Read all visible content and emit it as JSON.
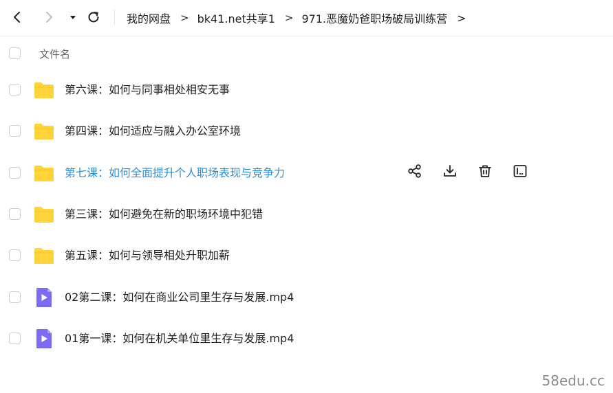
{
  "breadcrumb": {
    "items": [
      "我的网盘",
      "bk41.net共享1",
      "971.恶魔奶爸职场破局训练营"
    ],
    "separator": ">"
  },
  "list_header": {
    "name_label": "文件名"
  },
  "files": [
    {
      "name": "第六课：如何与同事相处相安无事",
      "type": "folder"
    },
    {
      "name": "第四课：如何适应与融入办公室环境",
      "type": "folder"
    },
    {
      "name": "第七课：如何全面提升个人职场表现与竞争力",
      "type": "folder",
      "hovered": true
    },
    {
      "name": "第三课：如何避免在新的职场环境中犯错",
      "type": "folder"
    },
    {
      "name": "第五课：如何与领导相处升职加薪",
      "type": "folder"
    },
    {
      "name": "02第二课：如何在商业公司里生存与发展.mp4",
      "type": "video"
    },
    {
      "name": "01第一课：如何在机关单位里生存与发展.mp4",
      "type": "video"
    }
  ],
  "row_actions": [
    "share-icon",
    "download-icon",
    "delete-icon",
    "rename-icon"
  ],
  "watermark": "58edu.cc",
  "colors": {
    "accent": "#2a8ed6",
    "folder": "#ffd43b",
    "video": "#7b6cf2"
  }
}
